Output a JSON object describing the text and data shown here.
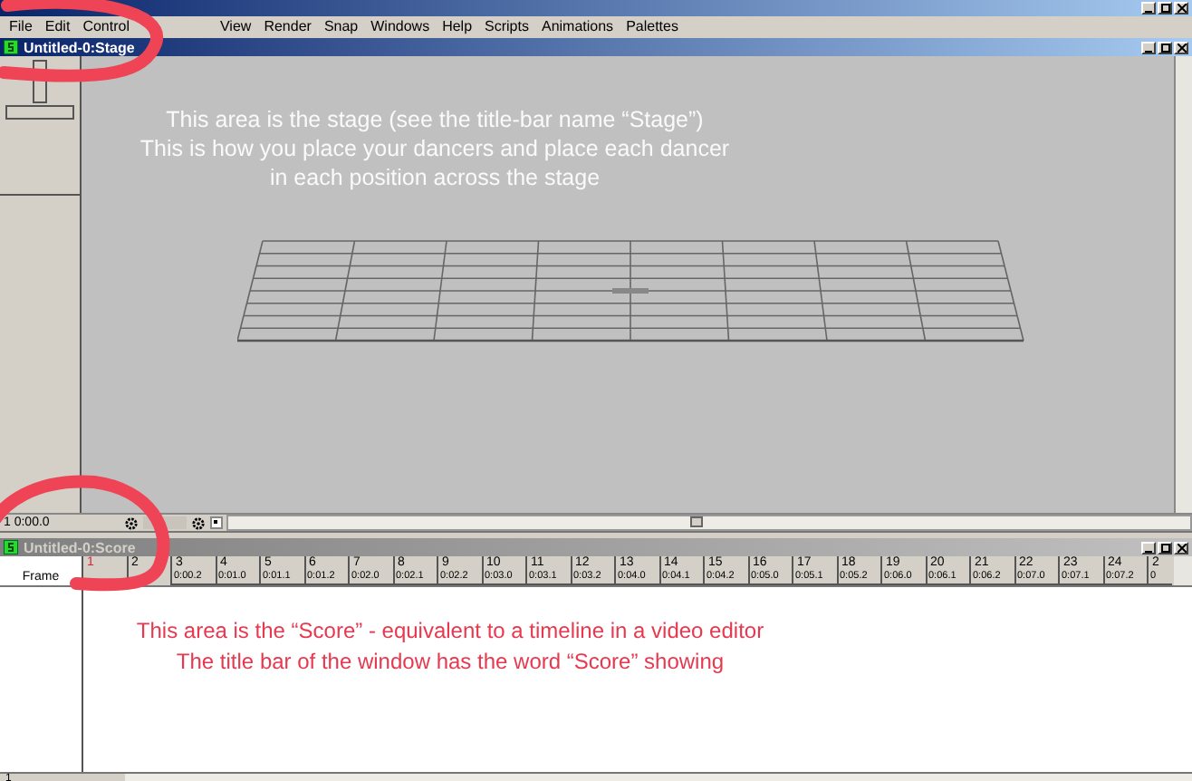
{
  "menu": [
    {
      "label": "File"
    },
    {
      "label": "Edit"
    },
    {
      "label": "Control"
    },
    {
      "label": "View"
    },
    {
      "label": "Render"
    },
    {
      "label": "Snap"
    },
    {
      "label": "Windows"
    },
    {
      "label": "Help"
    },
    {
      "label": "Scripts"
    },
    {
      "label": "Animations"
    },
    {
      "label": "Palettes"
    }
  ],
  "stage_window": {
    "title": "Untitled-0:Stage",
    "active": true,
    "note": "This area is the stage (see the title-bar name “Stage”)\nThis is how you place your dancers and place each dancer\nin each position across the stage",
    "frame": "1",
    "time": "0:00.0"
  },
  "score_window": {
    "title": "Untitled-0:Score",
    "active": false,
    "row_label": "Frame",
    "frames": [
      {
        "number": "1",
        "selected": true
      },
      {
        "number": "2",
        "selected": false
      },
      {
        "number": "3",
        "time": "0:00.2",
        "selected": false
      },
      {
        "number": "4",
        "time": "0:01.0",
        "selected": false
      },
      {
        "number": "5",
        "time": "0:01.1",
        "selected": false
      },
      {
        "number": "6",
        "time": "0:01.2",
        "selected": false
      },
      {
        "number": "7",
        "time": "0:02.0",
        "selected": false
      },
      {
        "number": "8",
        "time": "0:02.1",
        "selected": false
      },
      {
        "number": "9",
        "time": "0:02.2",
        "selected": false
      },
      {
        "number": "10",
        "time": "0:03.0",
        "selected": false
      },
      {
        "number": "11",
        "time": "0:03.1",
        "selected": false
      },
      {
        "number": "12",
        "time": "0:03.2",
        "selected": false
      },
      {
        "number": "13",
        "time": "0:04.0",
        "selected": false
      },
      {
        "number": "14",
        "time": "0:04.1",
        "selected": false
      },
      {
        "number": "15",
        "time": "0:04.2",
        "selected": false
      },
      {
        "number": "16",
        "time": "0:05.0",
        "selected": false
      },
      {
        "number": "17",
        "time": "0:05.1",
        "selected": false
      },
      {
        "number": "18",
        "time": "0:05.2",
        "selected": false
      },
      {
        "number": "19",
        "time": "0:06.0",
        "selected": false
      },
      {
        "number": "20",
        "time": "0:06.1",
        "selected": false
      },
      {
        "number": "21",
        "time": "0:06.2",
        "selected": false
      },
      {
        "number": "22",
        "time": "0:07.0",
        "selected": false
      },
      {
        "number": "23",
        "time": "0:07.1",
        "selected": false
      },
      {
        "number": "24",
        "time": "0:07.2",
        "selected": false
      },
      {
        "number": "2",
        "time": "0",
        "selected": false
      }
    ],
    "note": "This area is the “Score” - equivalent to a timeline in a video editor\nThe title bar of the window has the word “Score” showing",
    "bottom_frame": "1"
  }
}
